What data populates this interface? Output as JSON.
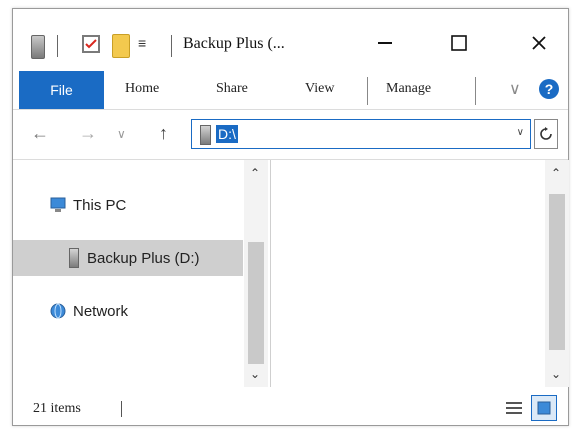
{
  "title": "Backup Plus (...",
  "ribbon": {
    "tabs": [
      "File",
      "Home",
      "Share",
      "View",
      "Manage"
    ]
  },
  "address": {
    "path": "D:\\"
  },
  "nav": {
    "items": [
      {
        "label": "This PC",
        "icon": "computer-icon",
        "selected": false
      },
      {
        "label": "Backup Plus (D:)",
        "icon": "drive-icon",
        "selected": true
      },
      {
        "label": "Network",
        "icon": "network-icon",
        "selected": false
      }
    ]
  },
  "status": {
    "items": "21 items"
  },
  "colors": {
    "accent": "#1a6bc4",
    "selection": "#cfcfcf"
  }
}
